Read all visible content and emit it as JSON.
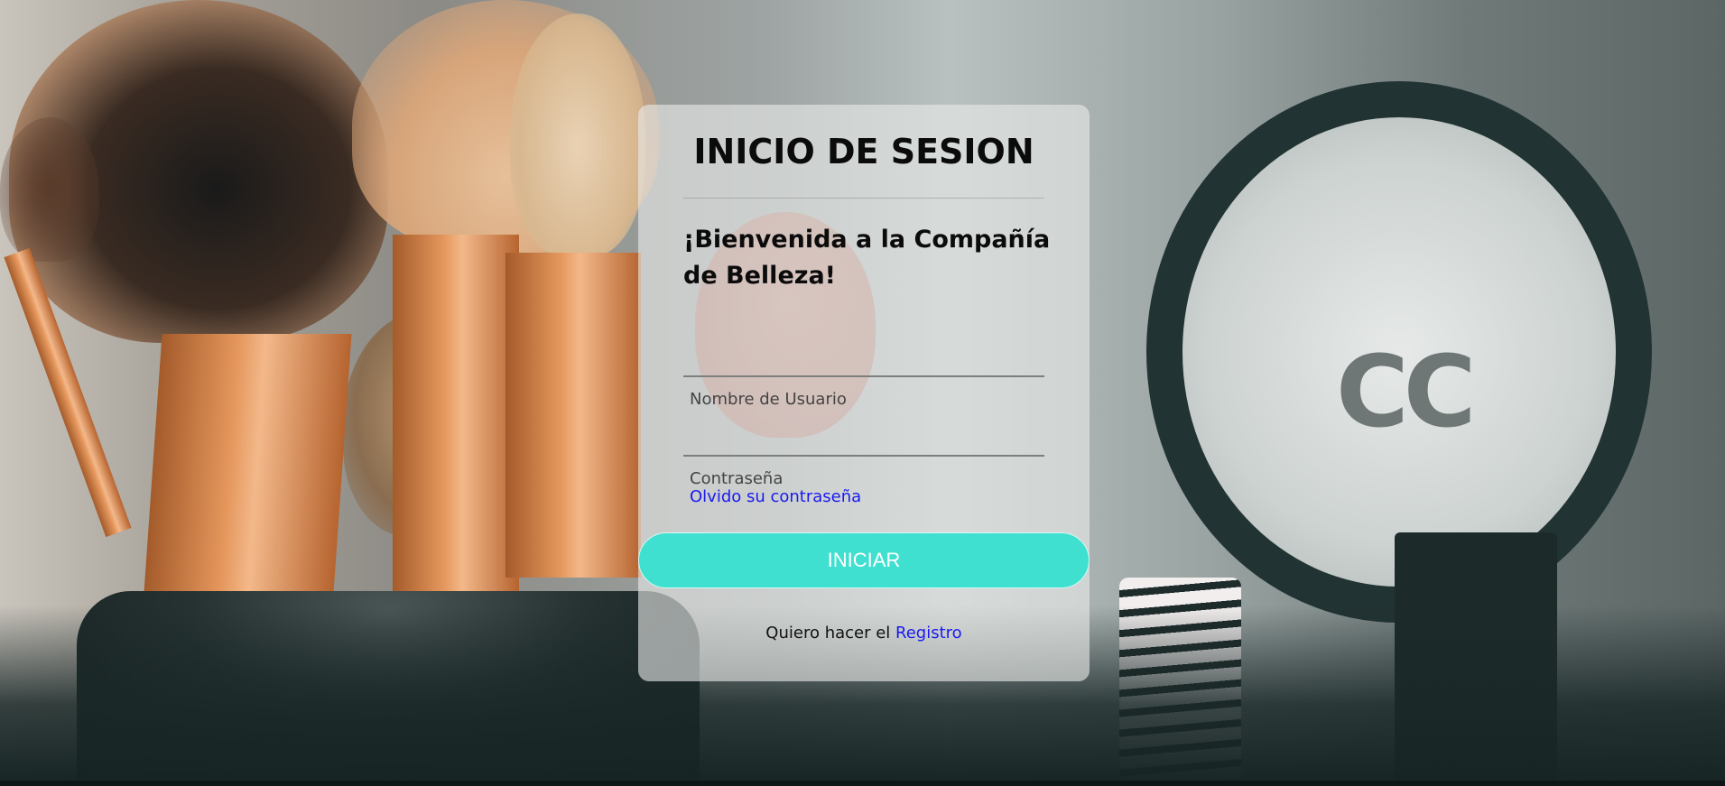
{
  "login": {
    "title": "INICIO DE SESION",
    "welcome": "¡Bienvenida a la Compañía de Belleza!",
    "username_label": "Nombre de Usuario",
    "password_label": "Contraseña",
    "username_value": "",
    "password_value": "",
    "forgot_link": "Olvido su contraseña",
    "submit_label": "INICIAR",
    "register_prompt": "Quiero hacer el",
    "register_link": "Registro"
  },
  "colors": {
    "accent": "#40e0d0",
    "link": "#1a1af0",
    "card_background": "rgba(232,234,232,0.62)"
  },
  "background": {
    "image": "makeup-brushes-photo"
  }
}
